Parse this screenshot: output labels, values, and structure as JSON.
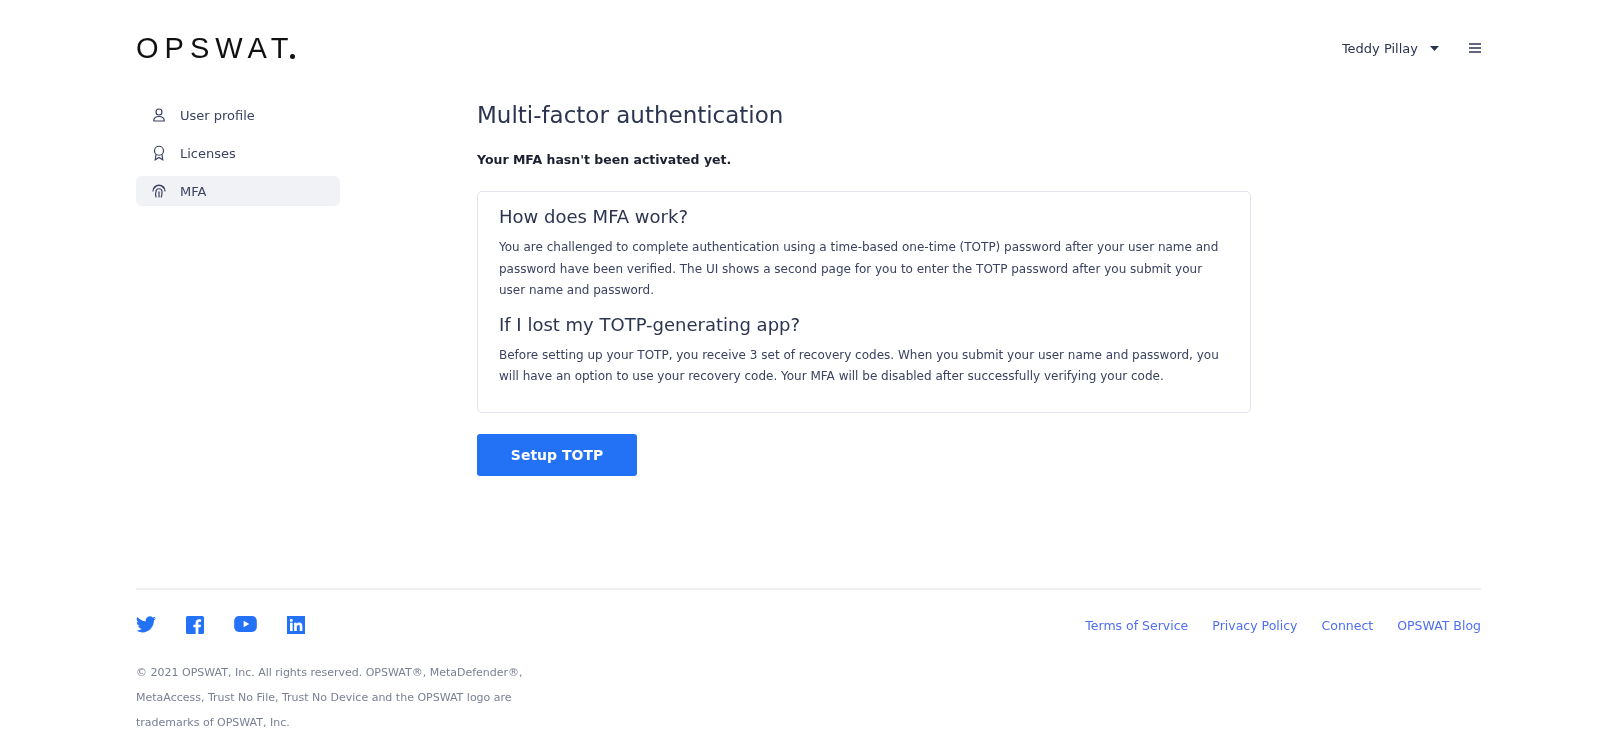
{
  "header": {
    "logo": "OPSWAT",
    "user_name": "Teddy Pillay"
  },
  "sidebar": {
    "items": [
      {
        "kind": "user",
        "label": "User profile",
        "selected": false
      },
      {
        "kind": "license",
        "label": "Licenses",
        "selected": false
      },
      {
        "kind": "fingerprint",
        "label": "MFA",
        "selected": true
      }
    ]
  },
  "main": {
    "title": "Multi-factor authentication",
    "status": "Your MFA hasn't been activated yet.",
    "sections": [
      {
        "heading": "How does MFA work?",
        "body": "You are challenged to complete authentication using a time-based one-time (TOTP) password after your user name and password have been verified. The UI shows a second page for you to enter the TOTP password after you submit your user name and password."
      },
      {
        "heading": "If I lost my TOTP-generating app?",
        "body": "Before setting up your TOTP, you receive 3 set of recovery codes. When you submit your user name and password, you will have an option to use your recovery code. Your MFA will be disabled after successfully verifying your code."
      }
    ],
    "button": "Setup TOTP"
  },
  "footer": {
    "social": [
      {
        "kind": "twitter"
      },
      {
        "kind": "facebook"
      },
      {
        "kind": "youtube"
      },
      {
        "kind": "linkedin"
      }
    ],
    "links": [
      "Terms of Service",
      "Privacy Policy",
      "Connect",
      "OPSWAT Blog"
    ],
    "copyright": "© 2021 OPSWAT, Inc. All rights reserved. OPSWAT®, MetaDefender®, MetaAccess, Trust No File, Trust No Device and the OPSWAT logo are trademarks of OPSWAT, Inc."
  }
}
